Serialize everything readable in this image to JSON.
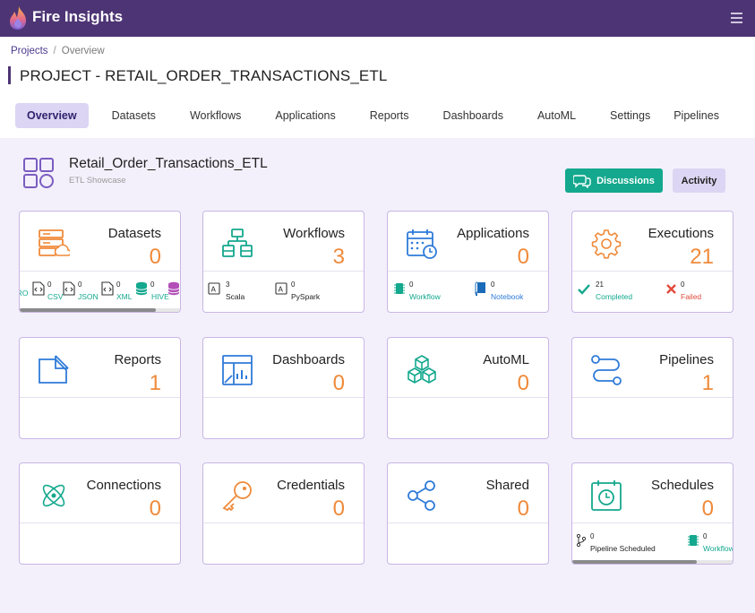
{
  "app": {
    "brand": "Fire Insights"
  },
  "breadcrumb": {
    "projects": "Projects",
    "separator": "/",
    "current": "Overview"
  },
  "page": {
    "title": "PROJECT - RETAIL_ORDER_TRANSACTIONS_ETL"
  },
  "tabs": [
    {
      "label": "Overview",
      "active": true
    },
    {
      "label": "Datasets"
    },
    {
      "label": "Workflows"
    },
    {
      "label": "Applications"
    },
    {
      "label": "Reports"
    },
    {
      "label": "Dashboards"
    },
    {
      "label": "AutoML"
    },
    {
      "label": "Settings"
    },
    {
      "label": "Pipelines"
    }
  ],
  "project": {
    "name": "Retail_Order_Transactions_ETL",
    "subtitle": "ETL Showcase"
  },
  "buttons": {
    "discussions": "Discussions",
    "activity": "Activity"
  },
  "colors": {
    "topbar": "#4d3474",
    "accent_value": "#ef8a3a",
    "discussions": "#14a88e",
    "teal_label": "#14a88e",
    "failed": "#e24a3b"
  },
  "cards": {
    "datasets": {
      "title": "Datasets",
      "value": "0",
      "icon": "dataset-server-icon",
      "subs": [
        {
          "label": "AVRO",
          "count": ""
        },
        {
          "label": "CSV",
          "count": "0"
        },
        {
          "label": "JSON",
          "count": "0"
        },
        {
          "label": "XML",
          "count": "0"
        },
        {
          "label": "HIVE",
          "count": "0"
        }
      ]
    },
    "workflows": {
      "title": "Workflows",
      "value": "3",
      "icon": "workflow-icon",
      "subs": [
        {
          "label": "Scala",
          "count": "3"
        },
        {
          "label": "PySpark",
          "count": "0"
        }
      ]
    },
    "applications": {
      "title": "Applications",
      "value": "0",
      "icon": "calendar-clock-icon",
      "subs": [
        {
          "label": "Workflow",
          "count": "0"
        },
        {
          "label": "Notebook",
          "count": "0"
        }
      ]
    },
    "executions": {
      "title": "Executions",
      "value": "21",
      "icon": "gear-icon",
      "subs": [
        {
          "label": "Completed",
          "count": "21"
        },
        {
          "label": "Failed",
          "count": "0"
        }
      ]
    },
    "reports": {
      "title": "Reports",
      "value": "1",
      "icon": "report-icon"
    },
    "dashboards": {
      "title": "Dashboards",
      "value": "0",
      "icon": "dashboard-icon"
    },
    "automl": {
      "title": "AutoML",
      "value": "0",
      "icon": "cubes-icon"
    },
    "pipelines": {
      "title": "Pipelines",
      "value": "1",
      "icon": "pipeline-icon"
    },
    "connections": {
      "title": "Connections",
      "value": "0",
      "icon": "atom-icon"
    },
    "credentials": {
      "title": "Credentials",
      "value": "0",
      "icon": "key-icon"
    },
    "shared": {
      "title": "Shared",
      "value": "0",
      "icon": "share-icon"
    },
    "schedules": {
      "title": "Schedules",
      "value": "0",
      "icon": "schedule-icon",
      "subs": [
        {
          "label": "Pipeline Scheduled",
          "count": "0"
        },
        {
          "label": "Workflow",
          "count": "0"
        }
      ]
    }
  }
}
